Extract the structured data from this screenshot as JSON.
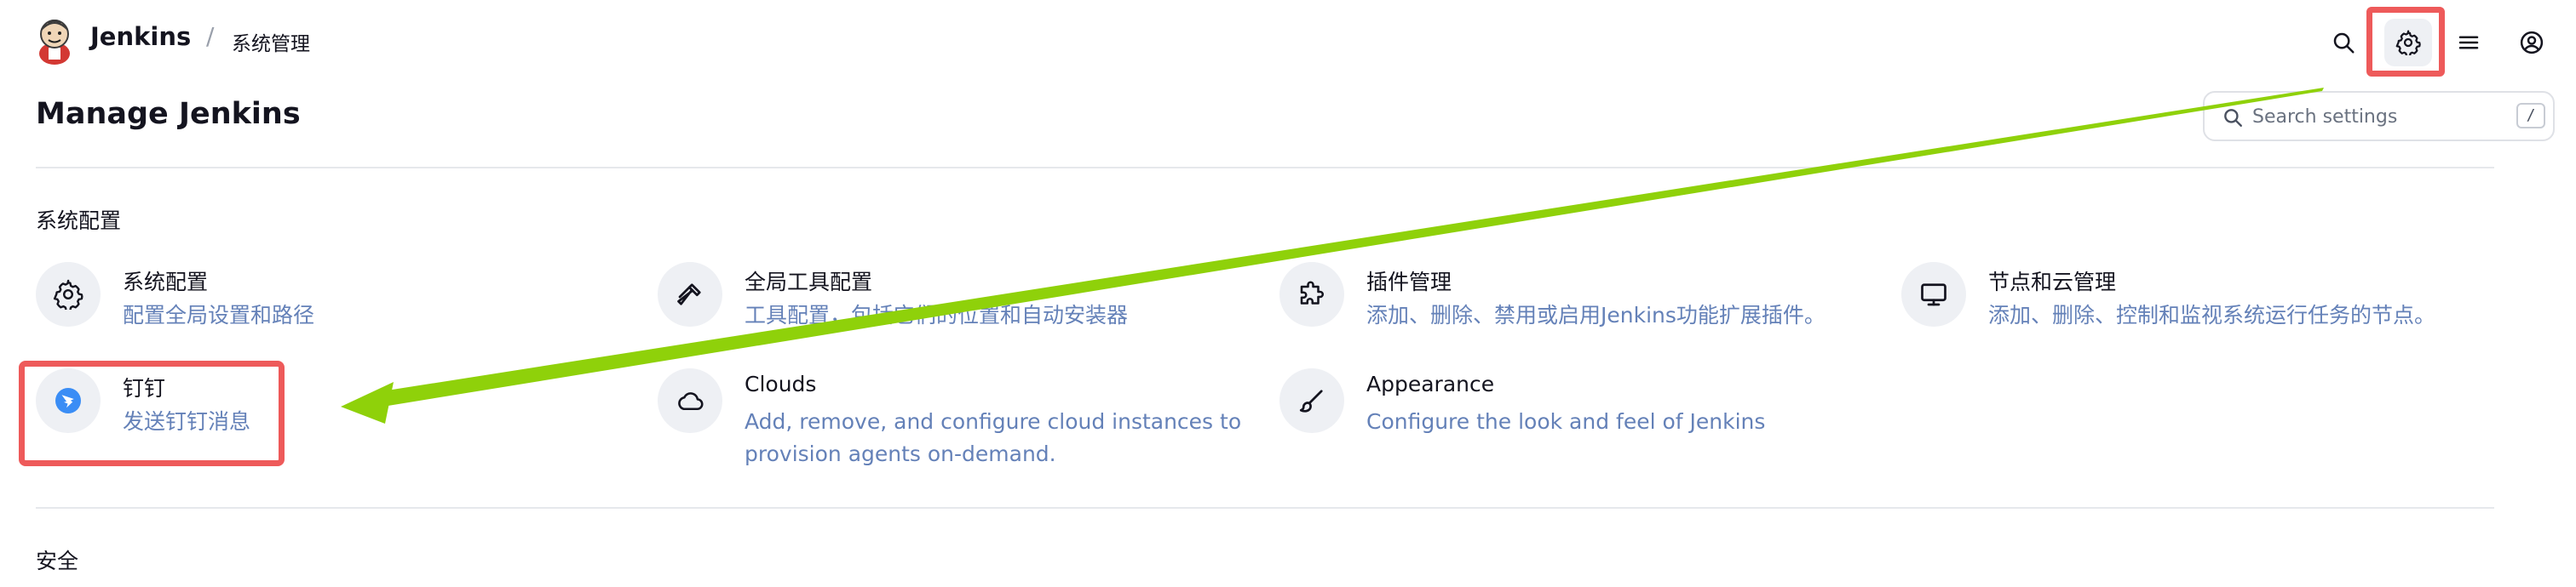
{
  "header": {
    "brand": "Jenkins",
    "breadcrumb_separator": "/",
    "breadcrumb": "系统管理",
    "icons": [
      "search-icon",
      "gear-icon",
      "hamburger-menu-icon",
      "user-circle-icon"
    ]
  },
  "page": {
    "title": "Manage Jenkins"
  },
  "search": {
    "placeholder": "Search settings",
    "shortcut": "/"
  },
  "sections": [
    {
      "title": "系统配置",
      "items": [
        {
          "title": "系统配置",
          "description": "配置全局设置和路径",
          "icon": "gear-icon"
        },
        {
          "title": "全局工具配置",
          "description": "工具配置，包括它们的位置和自动安装器",
          "icon": "hammer-icon"
        },
        {
          "title": "插件管理",
          "description": "添加、删除、禁用或启用Jenkins功能扩展插件。",
          "icon": "puzzle-icon"
        },
        {
          "title": "节点和云管理",
          "description": "添加、删除、控制和监视系统运行任务的节点。",
          "icon": "monitor-icon"
        },
        {
          "title": "钉钉",
          "description": "发送钉钉消息",
          "icon": "dingtalk-icon"
        },
        {
          "title": "Clouds",
          "description": "Add, remove, and configure cloud instances to provision agents on-demand.",
          "icon": "cloud-icon"
        },
        {
          "title": "Appearance",
          "description": "Configure the look and feel of Jenkins",
          "icon": "brush-icon"
        }
      ]
    },
    {
      "title": "安全"
    }
  ],
  "annotations": {
    "highlight_color": "#ee5a5a",
    "arrow_color": "#8fd10a"
  },
  "colors": {
    "link_description": "#6481b8",
    "icon_background": "#eef0f4",
    "dingtalk_blue": "#3a8df5"
  }
}
